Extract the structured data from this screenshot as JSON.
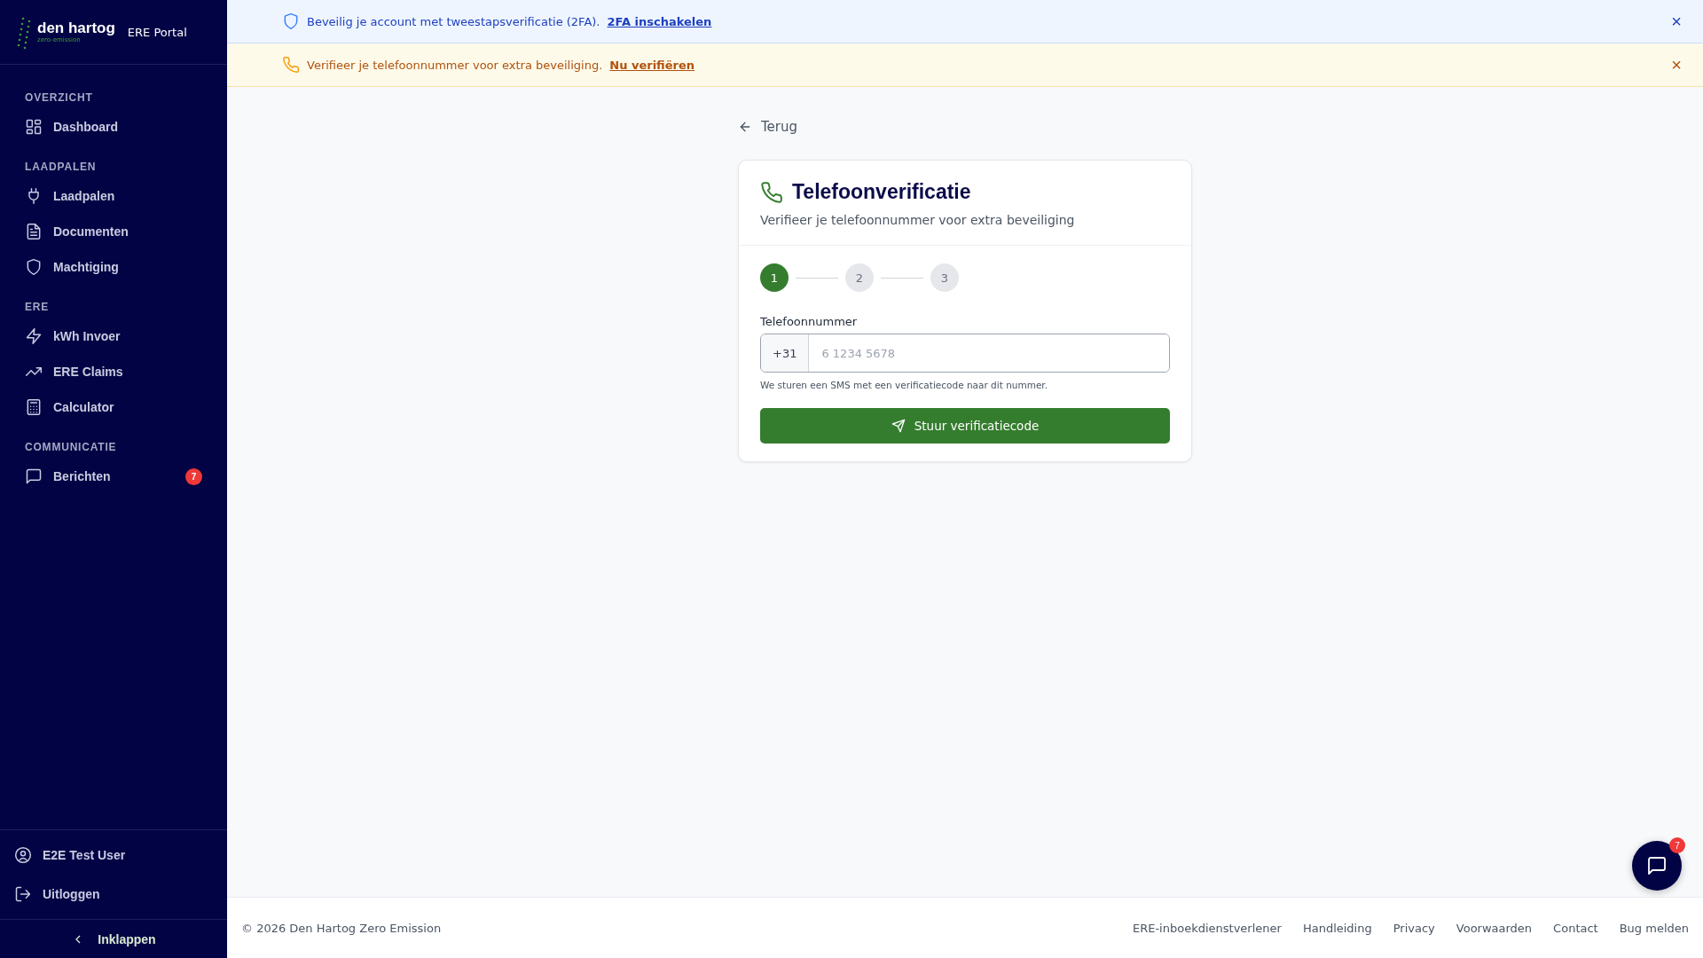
{
  "sidebar": {
    "logo": {
      "name": "den hartog",
      "tagline": "zero-emission"
    },
    "portal": "ERE Portal",
    "sections": [
      {
        "heading": "OVERZICHT",
        "items": [
          {
            "label": "Dashboard",
            "selected": false
          }
        ]
      },
      {
        "heading": "LAADPALEN",
        "items": [
          {
            "label": "Laadpalen",
            "selected": false
          },
          {
            "label": "Documenten",
            "selected": false
          },
          {
            "label": "Machtiging",
            "selected": false
          }
        ]
      },
      {
        "heading": "ERE",
        "items": [
          {
            "label": "kWh Invoer",
            "selected": false
          },
          {
            "label": "ERE Claims",
            "selected": false
          },
          {
            "label": "Calculator",
            "selected": false
          }
        ]
      },
      {
        "heading": "COMMUNICATIE",
        "items": [
          {
            "label": "Berichten",
            "selected": false,
            "badge": "7"
          }
        ]
      }
    ],
    "user": "E2E Test User",
    "logout": "Uitloggen",
    "collapse": "Inklappen"
  },
  "banners": [
    {
      "kind": "info",
      "text": "Beveilig je account met tweestapsverificatie (2FA).",
      "link": "2FA inschakelen",
      "close": "×"
    },
    {
      "kind": "warning",
      "text": "Verifieer je telefoonnummer voor extra beveiliging.",
      "link": "Nu verifiëren",
      "close": "×"
    }
  ],
  "back": "Terug",
  "card": {
    "title": "Telefoonverificatie",
    "subtitle": "Verifieer je telefoonnummer voor extra beveiliging",
    "steps": [
      {
        "label": "1",
        "selected": true
      },
      {
        "label": "2",
        "selected": false
      },
      {
        "label": "3",
        "selected": false
      }
    ],
    "field_label": "Telefoonnummer",
    "prefix": "+31",
    "placeholder": "6 1234 5678",
    "hint": "We sturen een SMS met een verificatiecode naar dit nummer.",
    "button": "Stuur verificatiecode"
  },
  "footer": {
    "copyright": "© 2026 Den Hartog Zero Emission",
    "links": [
      "ERE-inboekdienstverlener",
      "Handleiding",
      "Privacy",
      "Voorwaarden",
      "Contact",
      "Bug melden"
    ]
  },
  "chat": {
    "badge": "7"
  }
}
